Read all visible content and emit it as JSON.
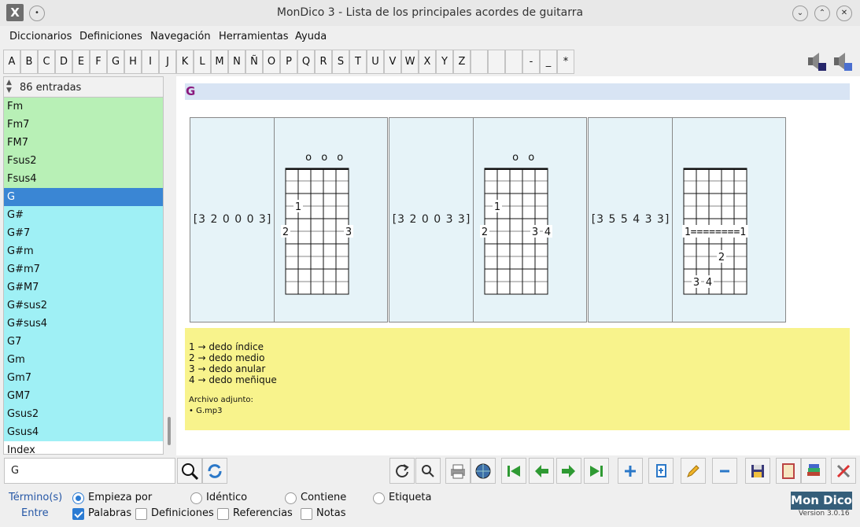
{
  "window": {
    "title": "MonDico 3 - Lista de los principales acordes de guitarra"
  },
  "menu": [
    "Diccionarios",
    "Definiciones",
    "Navegación",
    "Herramientas",
    "Ayuda"
  ],
  "letters": [
    "A",
    "B",
    "C",
    "D",
    "E",
    "F",
    "G",
    "H",
    "I",
    "J",
    "K",
    "L",
    "M",
    "N",
    "Ñ",
    "O",
    "P",
    "Q",
    "R",
    "S",
    "T",
    "U",
    "V",
    "W",
    "X",
    "Y",
    "Z",
    "",
    "",
    "",
    "-",
    "_",
    "*"
  ],
  "sidebar": {
    "count": "86 entradas",
    "entries": [
      {
        "label": "Fm",
        "color": "green"
      },
      {
        "label": "Fm7",
        "color": "green"
      },
      {
        "label": "FM7",
        "color": "green"
      },
      {
        "label": "Fsus2",
        "color": "green"
      },
      {
        "label": "Fsus4",
        "color": "green"
      },
      {
        "label": "G",
        "color": "selected"
      },
      {
        "label": "G#",
        "color": "cyan"
      },
      {
        "label": "G#7",
        "color": "cyan"
      },
      {
        "label": "G#m",
        "color": "cyan"
      },
      {
        "label": "G#m7",
        "color": "cyan"
      },
      {
        "label": "G#M7",
        "color": "cyan"
      },
      {
        "label": "G#sus2",
        "color": "cyan"
      },
      {
        "label": "G#sus4",
        "color": "cyan"
      },
      {
        "label": "G7",
        "color": "cyan"
      },
      {
        "label": "Gm",
        "color": "cyan"
      },
      {
        "label": "Gm7",
        "color": "cyan"
      },
      {
        "label": "GM7",
        "color": "cyan"
      },
      {
        "label": "Gsus2",
        "color": "cyan"
      },
      {
        "label": "Gsus4",
        "color": "cyan"
      },
      {
        "label": "Index",
        "color": "white"
      }
    ]
  },
  "entry": {
    "title": "G",
    "chords": [
      {
        "fingering": "[3 2 0 0 0 3]",
        "open": "o o o",
        "marks": [
          [
            "1",
            1,
            2
          ],
          [
            "2",
            0,
            3
          ],
          [
            "3",
            5,
            3
          ]
        ],
        "barre": ""
      },
      {
        "fingering": "[3 2 0 0 3 3]",
        "open": "o o",
        "marks": [
          [
            "1",
            1,
            2
          ],
          [
            "2",
            0,
            3
          ],
          [
            "3",
            4,
            3
          ],
          [
            "4",
            5,
            3
          ]
        ],
        "barre": ""
      },
      {
        "fingering": "[3 5 5 4 3 3]",
        "open": "",
        "marks": [
          [
            "2",
            3,
            4
          ],
          [
            "3",
            1,
            5
          ],
          [
            "4",
            2,
            5
          ]
        ],
        "barre": "1========1"
      }
    ],
    "notes": {
      "fingers": [
        "1 → dedo índice",
        "2 → dedo medio",
        "3 → dedo anular",
        "4 → dedo meñique"
      ],
      "attachment_label": "Archivo adjunto:",
      "attachment_file": "• G.mp3"
    }
  },
  "search": {
    "value": "G"
  },
  "filters": {
    "term_label": "Término(s)",
    "between_label": "Entre",
    "options": {
      "starts": "Empieza por",
      "identical": "Idéntico",
      "contains": "Contiene",
      "tag": "Etiqueta"
    },
    "checks": {
      "words": "Palabras",
      "definitions": "Definiciones",
      "references": "Referencias",
      "notes": "Notas"
    }
  },
  "logo": "Mon Dico",
  "version": "Version 3.0.16",
  "colors": {
    "selected": "#3a86d4",
    "green_entry": "#b8f0b6",
    "cyan_entry": "#9ff0f5",
    "notes_bg": "#f8f38c",
    "title_bg": "#d8e4f4"
  }
}
